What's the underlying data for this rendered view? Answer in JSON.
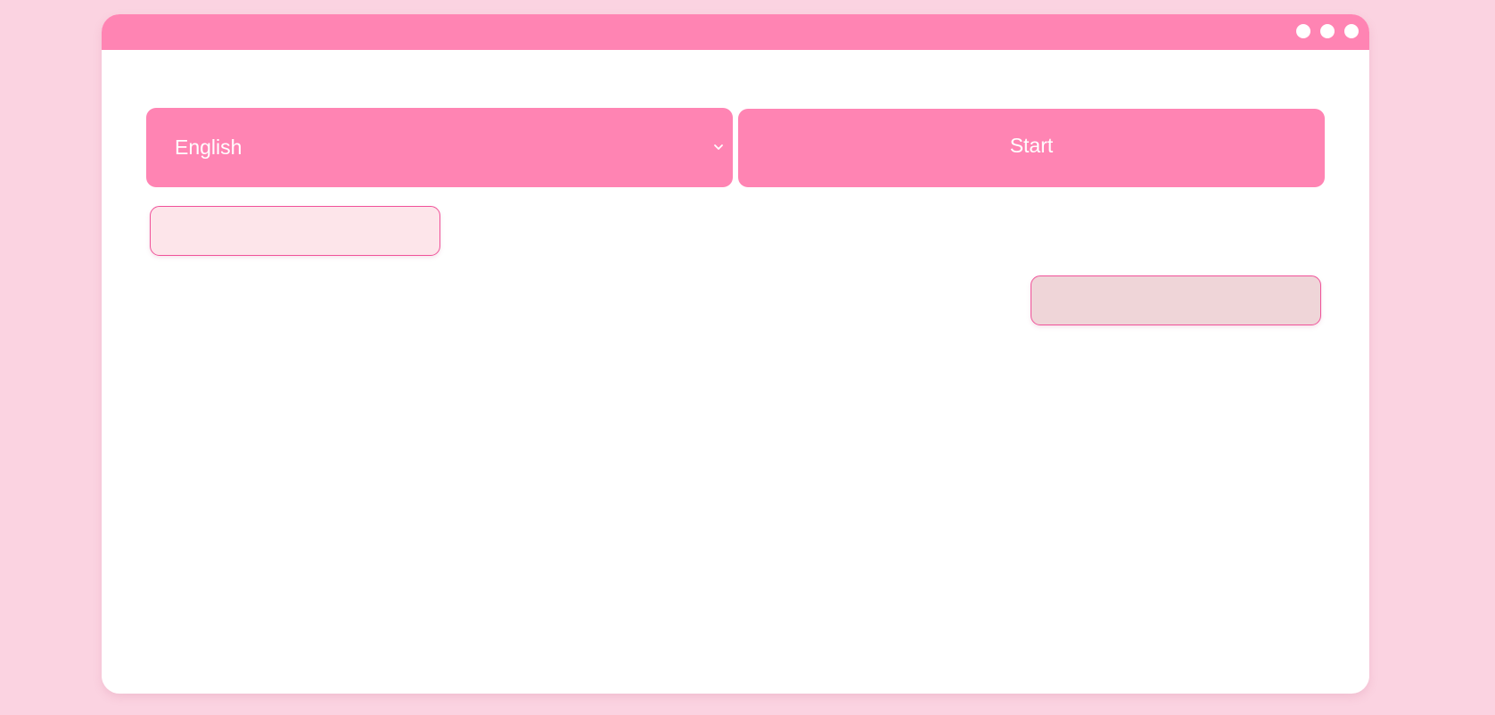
{
  "window": {
    "controls": [
      "dot-control",
      "dot-control",
      "dot-control"
    ]
  },
  "language_select": {
    "value": "English",
    "icon": "chevron-down-icon"
  },
  "start_button": {
    "label": "Start"
  },
  "colors": {
    "page_background": "#fbd3e1",
    "accent": "#ff84b3",
    "window_background": "#ffffff",
    "input_left_fill": "#fde5ea",
    "input_right_fill": "#efd5d8",
    "input_border": "#f0529a"
  }
}
